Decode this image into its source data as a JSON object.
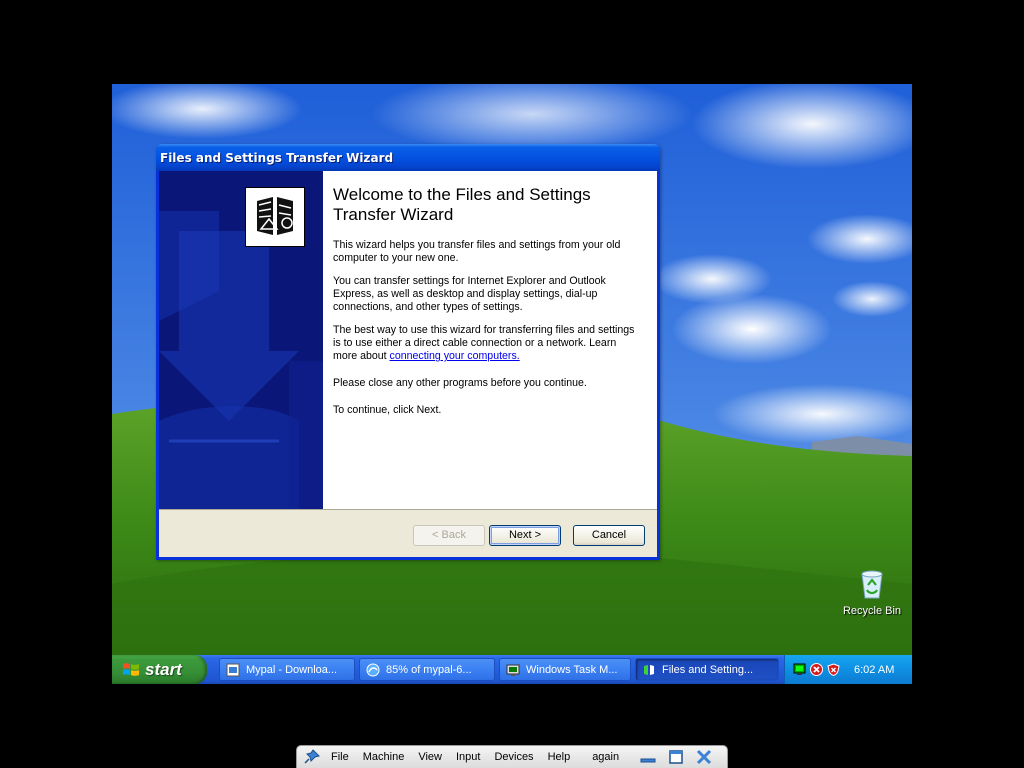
{
  "wizard": {
    "title": "Files and Settings Transfer Wizard",
    "heading": "Welcome to the Files and Settings Transfer Wizard",
    "para1": "This wizard helps you transfer files and settings from your old computer to your new one.",
    "para2": "You can transfer settings for Internet Explorer and Outlook Express, as well as desktop and display settings, dial-up connections, and other types of settings.",
    "para3_text": "The best way to use this wizard for transferring files and settings is to use either a direct cable connection or a network. Learn more about ",
    "para3_link": "connecting your computers.",
    "para4": "Please close any other programs before you continue.",
    "para5": "To continue, click Next.",
    "buttons": {
      "back": "< Back",
      "next": "Next >",
      "cancel": "Cancel"
    }
  },
  "desktop": {
    "recycle_bin_label": "Recycle Bin"
  },
  "taskbar": {
    "start_label": "start",
    "tasks": [
      {
        "label": "Mypal - Downloa...",
        "icon": "mypal-icon",
        "active": false
      },
      {
        "label": "85% of mypal-6...",
        "icon": "download-icon",
        "active": false
      },
      {
        "label": "Windows Task M...",
        "icon": "task-manager-icon",
        "active": false
      },
      {
        "label": "Files and Setting...",
        "icon": "transfer-wizard-icon",
        "active": true
      }
    ],
    "tray_icons": [
      "network-icon",
      "security-alert-icon",
      "security-shield-icon"
    ],
    "clock": "6:02 AM"
  },
  "vbox_toolbar": {
    "menus": [
      "File",
      "Machine",
      "View",
      "Input",
      "Devices",
      "Help"
    ],
    "extra_label": "again",
    "icons": [
      "pin-icon",
      "minimize-icon",
      "restore-icon",
      "close-icon"
    ]
  },
  "colors": {
    "titlebar_blue": "#0554e3",
    "side_panel_navy": "#0a1678",
    "taskbar_blue": "#245edb",
    "start_green": "#3c9a3c",
    "tray_blue": "#0f8fe3"
  }
}
